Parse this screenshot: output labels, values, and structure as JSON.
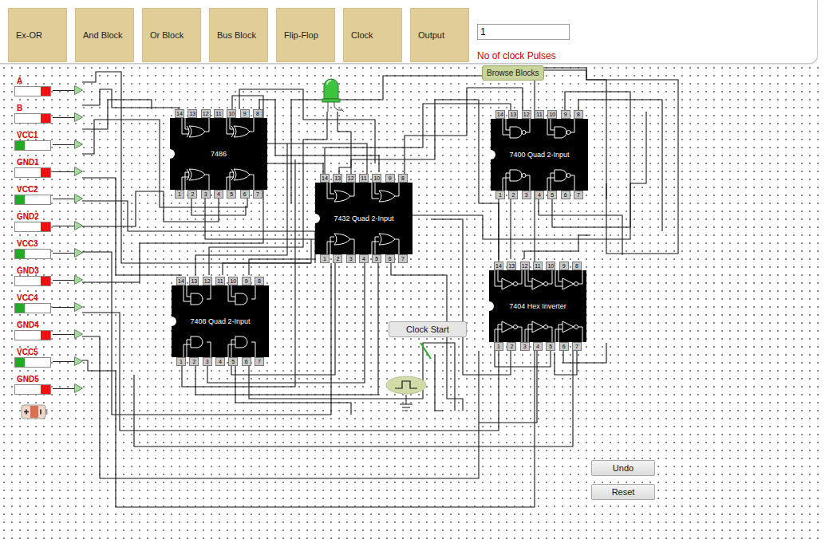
{
  "toolbar": {
    "buttons": [
      "Ex-OR",
      "And Block",
      "Or Block",
      "Bus Block",
      "Flip-Flop",
      "Clock",
      "Output"
    ],
    "clock_pulses": {
      "value": "1",
      "label": "No of clock Pulses"
    },
    "browse_button": "Browse Blocks"
  },
  "switches": [
    {
      "label": "A",
      "on": false
    },
    {
      "label": "B",
      "on": false
    },
    {
      "label": "VCC1",
      "on": true
    },
    {
      "label": "GND1",
      "on": false
    },
    {
      "label": "VCC2",
      "on": true
    },
    {
      "label": "GND2",
      "on": false
    },
    {
      "label": "VCC3",
      "on": true
    },
    {
      "label": "GND3",
      "on": false
    },
    {
      "label": "VCC4",
      "on": true
    },
    {
      "label": "GND4",
      "on": false
    },
    {
      "label": "VCC5",
      "on": true
    },
    {
      "label": "GND5",
      "on": false
    }
  ],
  "led": {
    "on": true
  },
  "chips": [
    {
      "label": "7486",
      "kind": "xor"
    },
    {
      "label": "7432 Quad 2-Input",
      "kind": "or"
    },
    {
      "label": "7408 Quad 2-Input",
      "kind": "and"
    },
    {
      "label": "7400 Quad 2-Input",
      "kind": "nand"
    },
    {
      "label": "7404 Hex Inverter",
      "kind": "not"
    }
  ],
  "pins": {
    "top": [
      "14",
      "13",
      "12",
      "11",
      "10",
      "9",
      "8"
    ],
    "bottom": [
      "1",
      "2",
      "3",
      "4",
      "5",
      "6",
      "7"
    ]
  },
  "clock": {
    "button": "Clock Start"
  },
  "buttons": [
    "Undo",
    "Reset"
  ]
}
